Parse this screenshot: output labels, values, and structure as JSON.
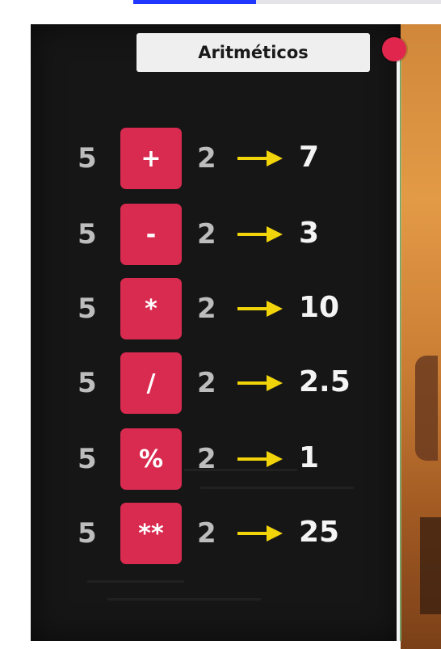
{
  "player": {
    "progress_percent": 40
  },
  "board": {
    "title": "Aritméticos",
    "accent_color": "#d92a4f",
    "arrow_color": "#f2d40a",
    "rows": [
      {
        "a": "5",
        "op": "+",
        "b": "2",
        "result": "7"
      },
      {
        "a": "5",
        "op": "-",
        "b": "2",
        "result": "3"
      },
      {
        "a": "5",
        "op": "*",
        "b": "2",
        "result": "10"
      },
      {
        "a": "5",
        "op": "/",
        "b": "2",
        "result": "2.5"
      },
      {
        "a": "5",
        "op": "%",
        "b": "2",
        "result": "1"
      },
      {
        "a": "5",
        "op": "**",
        "b": "2",
        "result": "25"
      }
    ]
  }
}
